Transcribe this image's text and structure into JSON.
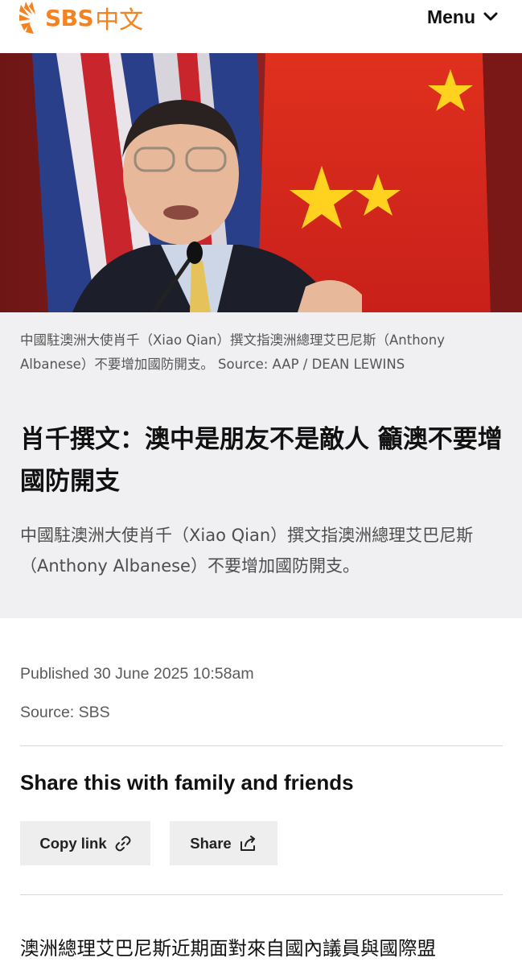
{
  "header": {
    "logo_text": "SBS",
    "logo_cn": "中文",
    "menu_label": "Menu",
    "brand_color": "#f58220"
  },
  "hero": {
    "caption": "中國駐澳洲大使肖千（Xiao Qian）撰文指澳洲總理艾巴尼斯（Anthony Albanese）不要增加國防開支。 Source: AAP / DEAN LEWINS"
  },
  "article": {
    "title": "肖千撰文：澳中是朋友不是敵人 籲澳不要增國防開支",
    "standfirst": "中國駐澳洲大使肖千（Xiao Qian）撰文指澳洲總理艾巴尼斯（Anthony Albanese）不要增加國防開支。",
    "published": "Published 30 June 2025 10:58am",
    "source": "Source: SBS",
    "body_first_line": "澳洲總理艾巴尼斯近期面對來自國內議員與國際盟"
  },
  "share": {
    "heading": "Share this with family and friends",
    "copy_label": "Copy link",
    "share_label": "Share"
  },
  "icons": {
    "logo": "sbs-sunburst-icon",
    "menu": "chevron-down-icon",
    "copy": "link-icon",
    "share": "share-icon"
  }
}
